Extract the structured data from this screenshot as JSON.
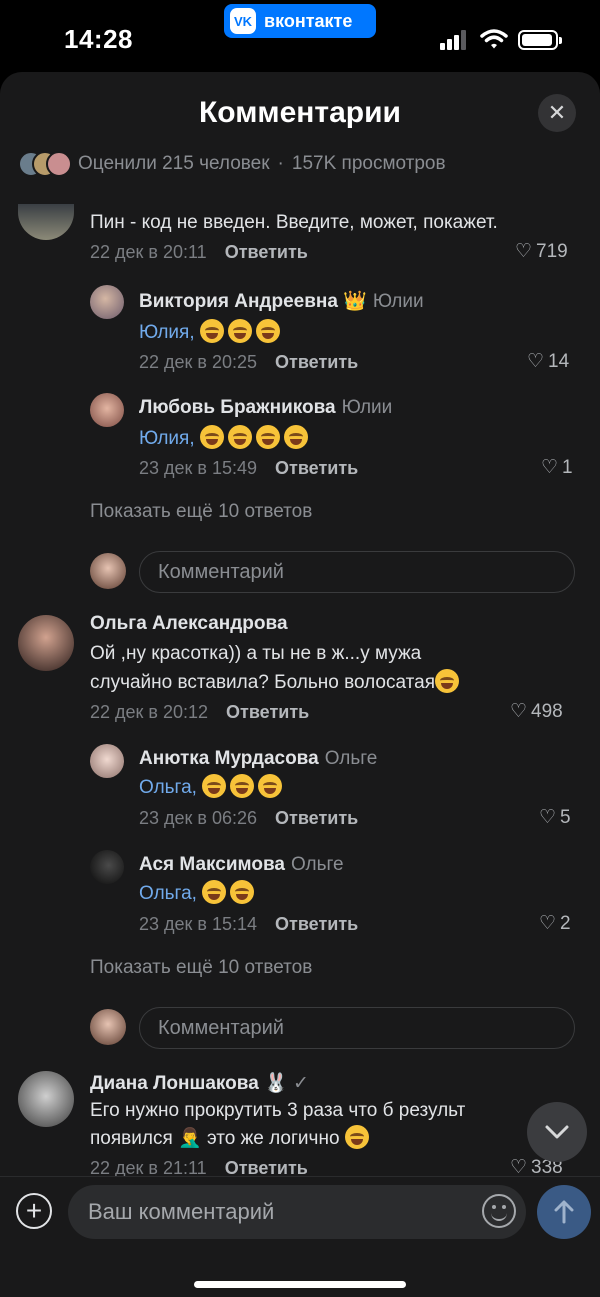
{
  "status": {
    "time": "14:28",
    "app_badge": "вконтакте"
  },
  "header": {
    "title": "Комментарии",
    "meta_rated": "Оценили 215 человек",
    "meta_sep": "·",
    "meta_views": "157K просмотров"
  },
  "comments": [
    {
      "text": "Пин - код не введен. Введите, может, покажет.",
      "date": "22 дек в 20:11",
      "reply": "Ответить",
      "likes": "719",
      "replies": [
        {
          "name": "Виктория Андреевна",
          "to": "Юлии",
          "mention": "Юлия,",
          "date": "22 дек в 20:25",
          "reply": "Ответить",
          "likes": "14"
        },
        {
          "name": "Любовь Бражникова",
          "to": "Юлии",
          "mention": "Юлия,",
          "date": "23 дек в 15:49",
          "reply": "Ответить",
          "likes": "1"
        }
      ],
      "show_more": "Показать ещё 10 ответов",
      "reply_placeholder": "Комментарий"
    },
    {
      "name": "Ольга Александрова",
      "text_line1": "Ой ,ну красотка)) а ты не в ж...у мужа",
      "text_line2": "случайно вставила? Больно волосатая",
      "date": "22 дек в 20:12",
      "reply": "Ответить",
      "likes": "498",
      "replies": [
        {
          "name": "Анютка Мурдасова",
          "to": "Ольге",
          "mention": "Ольга,",
          "date": "23 дек в 06:26",
          "reply": "Ответить",
          "likes": "5"
        },
        {
          "name": "Ася Максимова",
          "to": "Ольге",
          "mention": "Ольга,",
          "date": "23 дек в 15:14",
          "reply": "Ответить",
          "likes": "2"
        }
      ],
      "show_more": "Показать ещё 10 ответов",
      "reply_placeholder": "Комментарий"
    },
    {
      "name": "Диана Лоншакова",
      "text_line1": "Его нужно прокрутить 3 раза что б результ",
      "text_line2a": "появился",
      "text_line2b": "это же логично",
      "date": "22 дек в 21:11",
      "reply": "Ответить",
      "likes": "338"
    }
  ],
  "composer": {
    "placeholder": "Ваш комментарий"
  },
  "colors": {
    "accent": "#0077ff",
    "mention": "#71aaeb",
    "background": "#19191a"
  }
}
